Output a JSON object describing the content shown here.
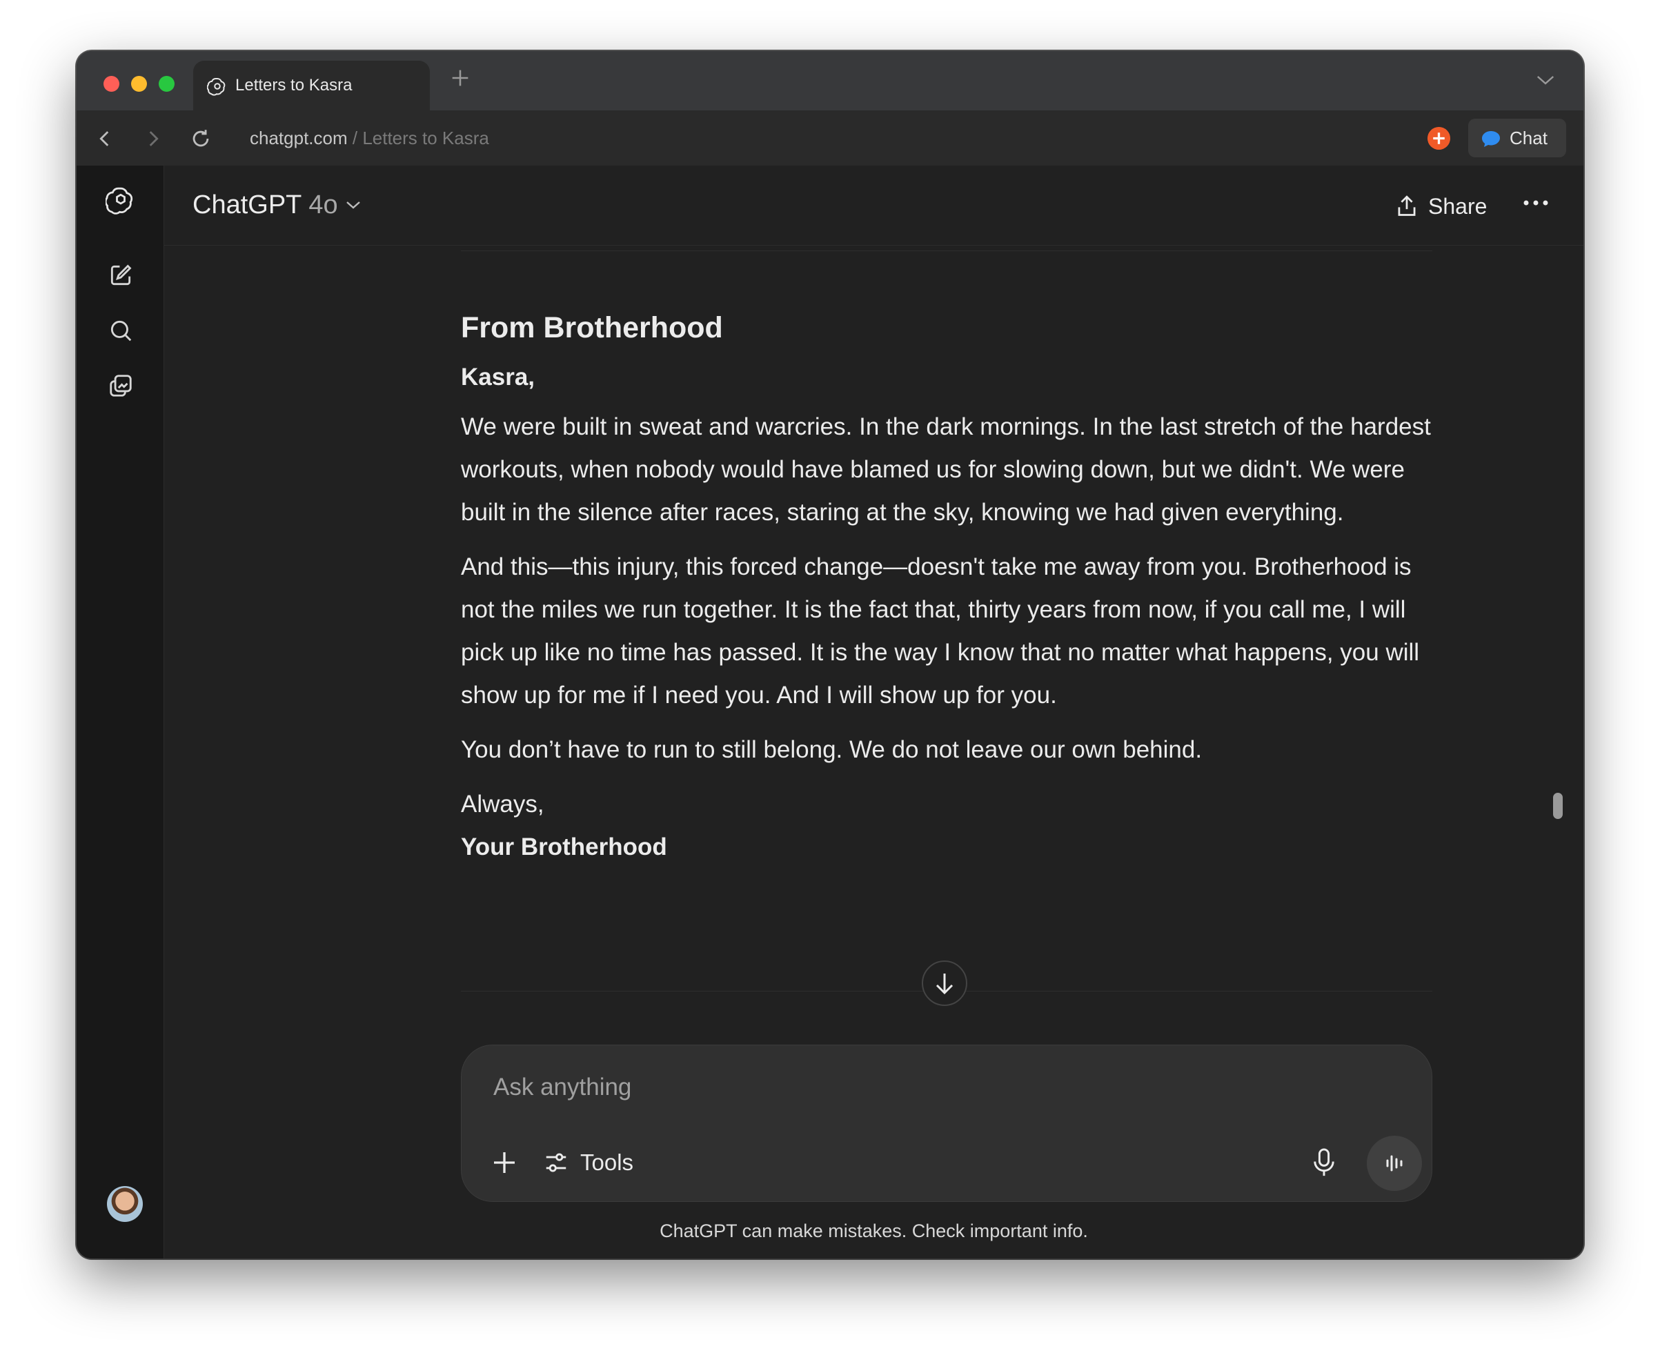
{
  "browser": {
    "tab_title": "Letters to Kasra",
    "address_host": "chatgpt.com",
    "address_separator": " / ",
    "address_path": "Letters to Kasra",
    "chat_button_label": "Chat",
    "new_tab_icon": "plus-icon"
  },
  "header": {
    "model_name": "ChatGPT",
    "model_version": "4o",
    "share_label": "Share"
  },
  "sidebar": {
    "icons": [
      "chatgpt-logo-icon",
      "new-chat-icon",
      "search-icon",
      "library-icon"
    ]
  },
  "message": {
    "title": "From Brotherhood",
    "greeting": "Kasra,",
    "paragraphs": [
      "We were built in sweat and warcries. In the dark mornings. In the last stretch of the hardest workouts, when nobody would have blamed us for slowing down, but we didn't. We were built in the silence after races, staring at the sky, knowing we had given everything.",
      "And this—this injury, this forced change—doesn't take me away from you. Brotherhood is not the miles we run together. It is the fact that, thirty years from now, if you call me, I will pick up like no time has passed. It is the way I know that no matter what happens, you will show up for me if I need you. And I will show up for you.",
      "You don’t have to run to still belong. We do not leave our own behind."
    ],
    "signoff": "Always,",
    "signature": "Your Brotherhood"
  },
  "composer": {
    "placeholder": "Ask anything",
    "tools_label": "Tools"
  },
  "footer": {
    "disclaimer": "ChatGPT can make mistakes. Check important info."
  },
  "colors": {
    "background": "#212121",
    "sidebar": "#181818",
    "accent_orange": "#f05a28",
    "chat_bubble_blue": "#2f8cf0"
  }
}
